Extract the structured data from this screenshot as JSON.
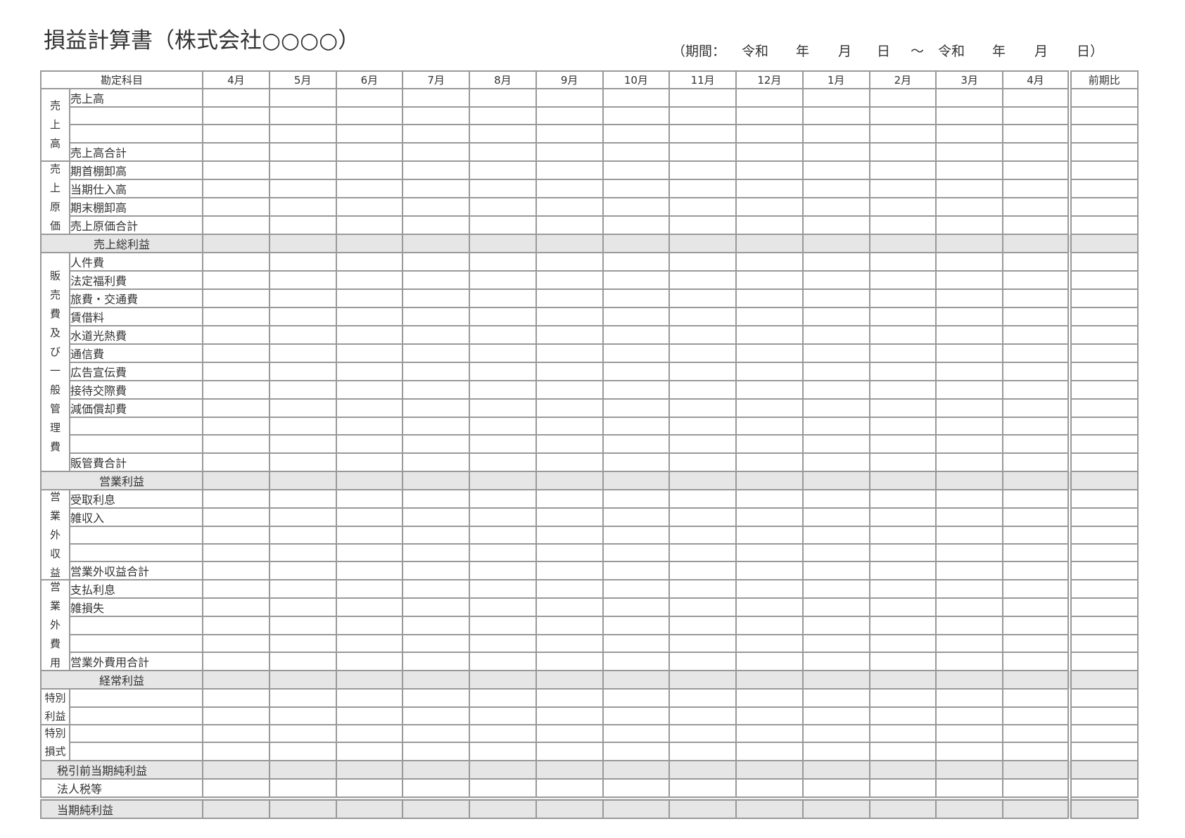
{
  "document": {
    "title": "損益計算書（株式会社○○○○）",
    "period": {
      "label": "（期間：",
      "start": {
        "era": "令和",
        "year": "",
        "year_unit": "年",
        "month": "",
        "month_unit": "月",
        "day": "",
        "day_unit": "日"
      },
      "separator": "～",
      "end": {
        "era": "令和",
        "year": "",
        "year_unit": "年",
        "month": "",
        "month_unit": "月",
        "day": "",
        "day_unit": "日"
      },
      "close": "）"
    }
  },
  "table": {
    "header": {
      "account": "勘定科目",
      "months": [
        "4月",
        "5月",
        "6月",
        "7月",
        "8月",
        "9月",
        "10月",
        "11月",
        "12月",
        "1月",
        "2月",
        "3月",
        "4月"
      ],
      "comparison": "前期比"
    },
    "sections": [
      {
        "type": "group",
        "category": "売上高",
        "items": [
          "売上高",
          "",
          ""
        ],
        "total": "売上高合計"
      },
      {
        "type": "group",
        "category": "売上原価",
        "items": [
          "期首棚卸高",
          "当期仕入高",
          "期末棚卸高"
        ],
        "total": "売上原価合計"
      },
      {
        "type": "profit",
        "label": "売上総利益",
        "shaded": true
      },
      {
        "type": "group",
        "category": "販売費及び一般管理費",
        "items": [
          "人件費",
          "法定福利費",
          "旅費・交通費",
          "賃借料",
          "水道光熱費",
          "通信費",
          "広告宣伝費",
          "接待交際費",
          "減価償却費",
          "",
          ""
        ],
        "total": "販管費合計"
      },
      {
        "type": "profit",
        "label": "営業利益",
        "shaded": true
      },
      {
        "type": "group",
        "category": "営業外収益",
        "items": [
          "受取利息",
          "雑収入",
          "",
          ""
        ],
        "total": "営業外収益合計"
      },
      {
        "type": "group",
        "category": "営業外費用",
        "items": [
          "支払利息",
          "雑損失",
          "",
          ""
        ],
        "total": "営業外費用合計"
      },
      {
        "type": "profit",
        "label": "経常利益",
        "shaded": true
      },
      {
        "type": "group",
        "category": "特別利益",
        "category_lines": [
          "特別",
          "利益"
        ],
        "items": [
          "",
          ""
        ]
      },
      {
        "type": "group",
        "category": "特別損式",
        "category_lines": [
          "特別",
          "損式"
        ],
        "items": [
          "",
          ""
        ]
      },
      {
        "type": "bottom-line",
        "label": "税引前当期純利益",
        "shaded": true
      },
      {
        "type": "bottom-line",
        "label": "法人税等",
        "shaded": false
      },
      {
        "type": "bottom-line",
        "label": "当期純利益",
        "shaded": true,
        "double_rule_above": true
      }
    ]
  },
  "colors": {
    "grid_line": "#999999",
    "summary_fill": "#e6e6e6",
    "text": "#333333"
  }
}
